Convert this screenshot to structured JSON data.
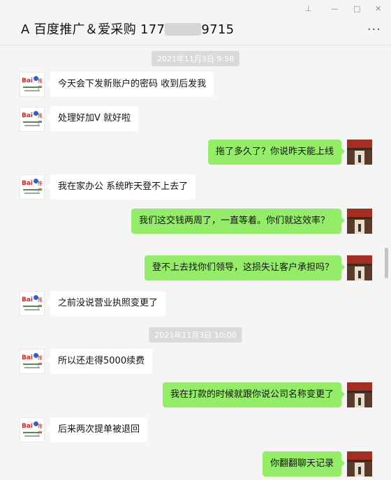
{
  "header": {
    "title_prefix": "A 百度推广＆爱采购 177",
    "title_suffix": "9715",
    "controls": {
      "pin": "⊥",
      "minimize": "—",
      "maximize": "□",
      "close": "✕"
    },
    "more": "···"
  },
  "timestamps": [
    "2021年11月3日 9:58",
    "2021年11月3日 10:00"
  ],
  "avatar_text": {
    "brand": "Bai",
    "product": "推广"
  },
  "messages": [
    {
      "side": "left",
      "text": "今天会下发新账户的密码 收到后发我"
    },
    {
      "side": "left",
      "text": "处理好加V 就好啦"
    },
    {
      "side": "right",
      "text": "拖了多久了？你说昨天能上线"
    },
    {
      "side": "left",
      "text": "我在家办公 系统昨天登不上去了"
    },
    {
      "side": "right",
      "text": "我们这交钱两周了，一直等着。你们就这效率？"
    },
    {
      "side": "right",
      "text": "登不上去找你们领导，这损失让客户承担吗？"
    },
    {
      "side": "left",
      "text": "之前没说营业执照变更了"
    },
    {
      "side": "left",
      "text": "所以还走得5000续费"
    },
    {
      "side": "right",
      "text": "我在打款的时候就跟你说公司名称变更了"
    },
    {
      "side": "left",
      "text": "后来两次提单被退回"
    },
    {
      "side": "right",
      "text": "你翻翻聊天记录"
    }
  ],
  "colors": {
    "self_bubble": "#95ec69",
    "other_bubble": "#ffffff",
    "background": "#f5f5f5"
  }
}
